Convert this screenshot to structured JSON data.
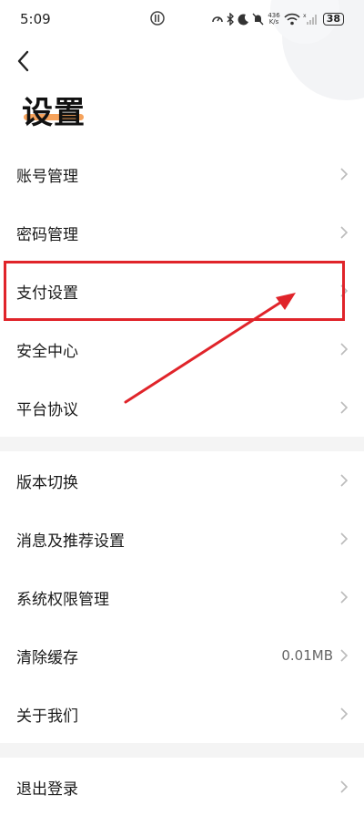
{
  "status_bar": {
    "time": "5:09",
    "net_speed_value": "436",
    "net_speed_unit": "K/s",
    "battery": "38"
  },
  "header": {
    "title": "设置"
  },
  "settings": {
    "group1": [
      {
        "label": "账号管理"
      },
      {
        "label": "密码管理"
      },
      {
        "label": "支付设置"
      },
      {
        "label": "安全中心"
      },
      {
        "label": "平台协议"
      }
    ],
    "group2": [
      {
        "label": "版本切换"
      },
      {
        "label": "消息及推荐设置"
      },
      {
        "label": "系统权限管理"
      },
      {
        "label": "清除缓存",
        "value": "0.01MB"
      },
      {
        "label": "关于我们"
      }
    ],
    "group3": [
      {
        "label": "退出登录"
      }
    ]
  },
  "annotation": {
    "highlight_color": "#e0242a",
    "arrow_color": "#e0242a"
  }
}
